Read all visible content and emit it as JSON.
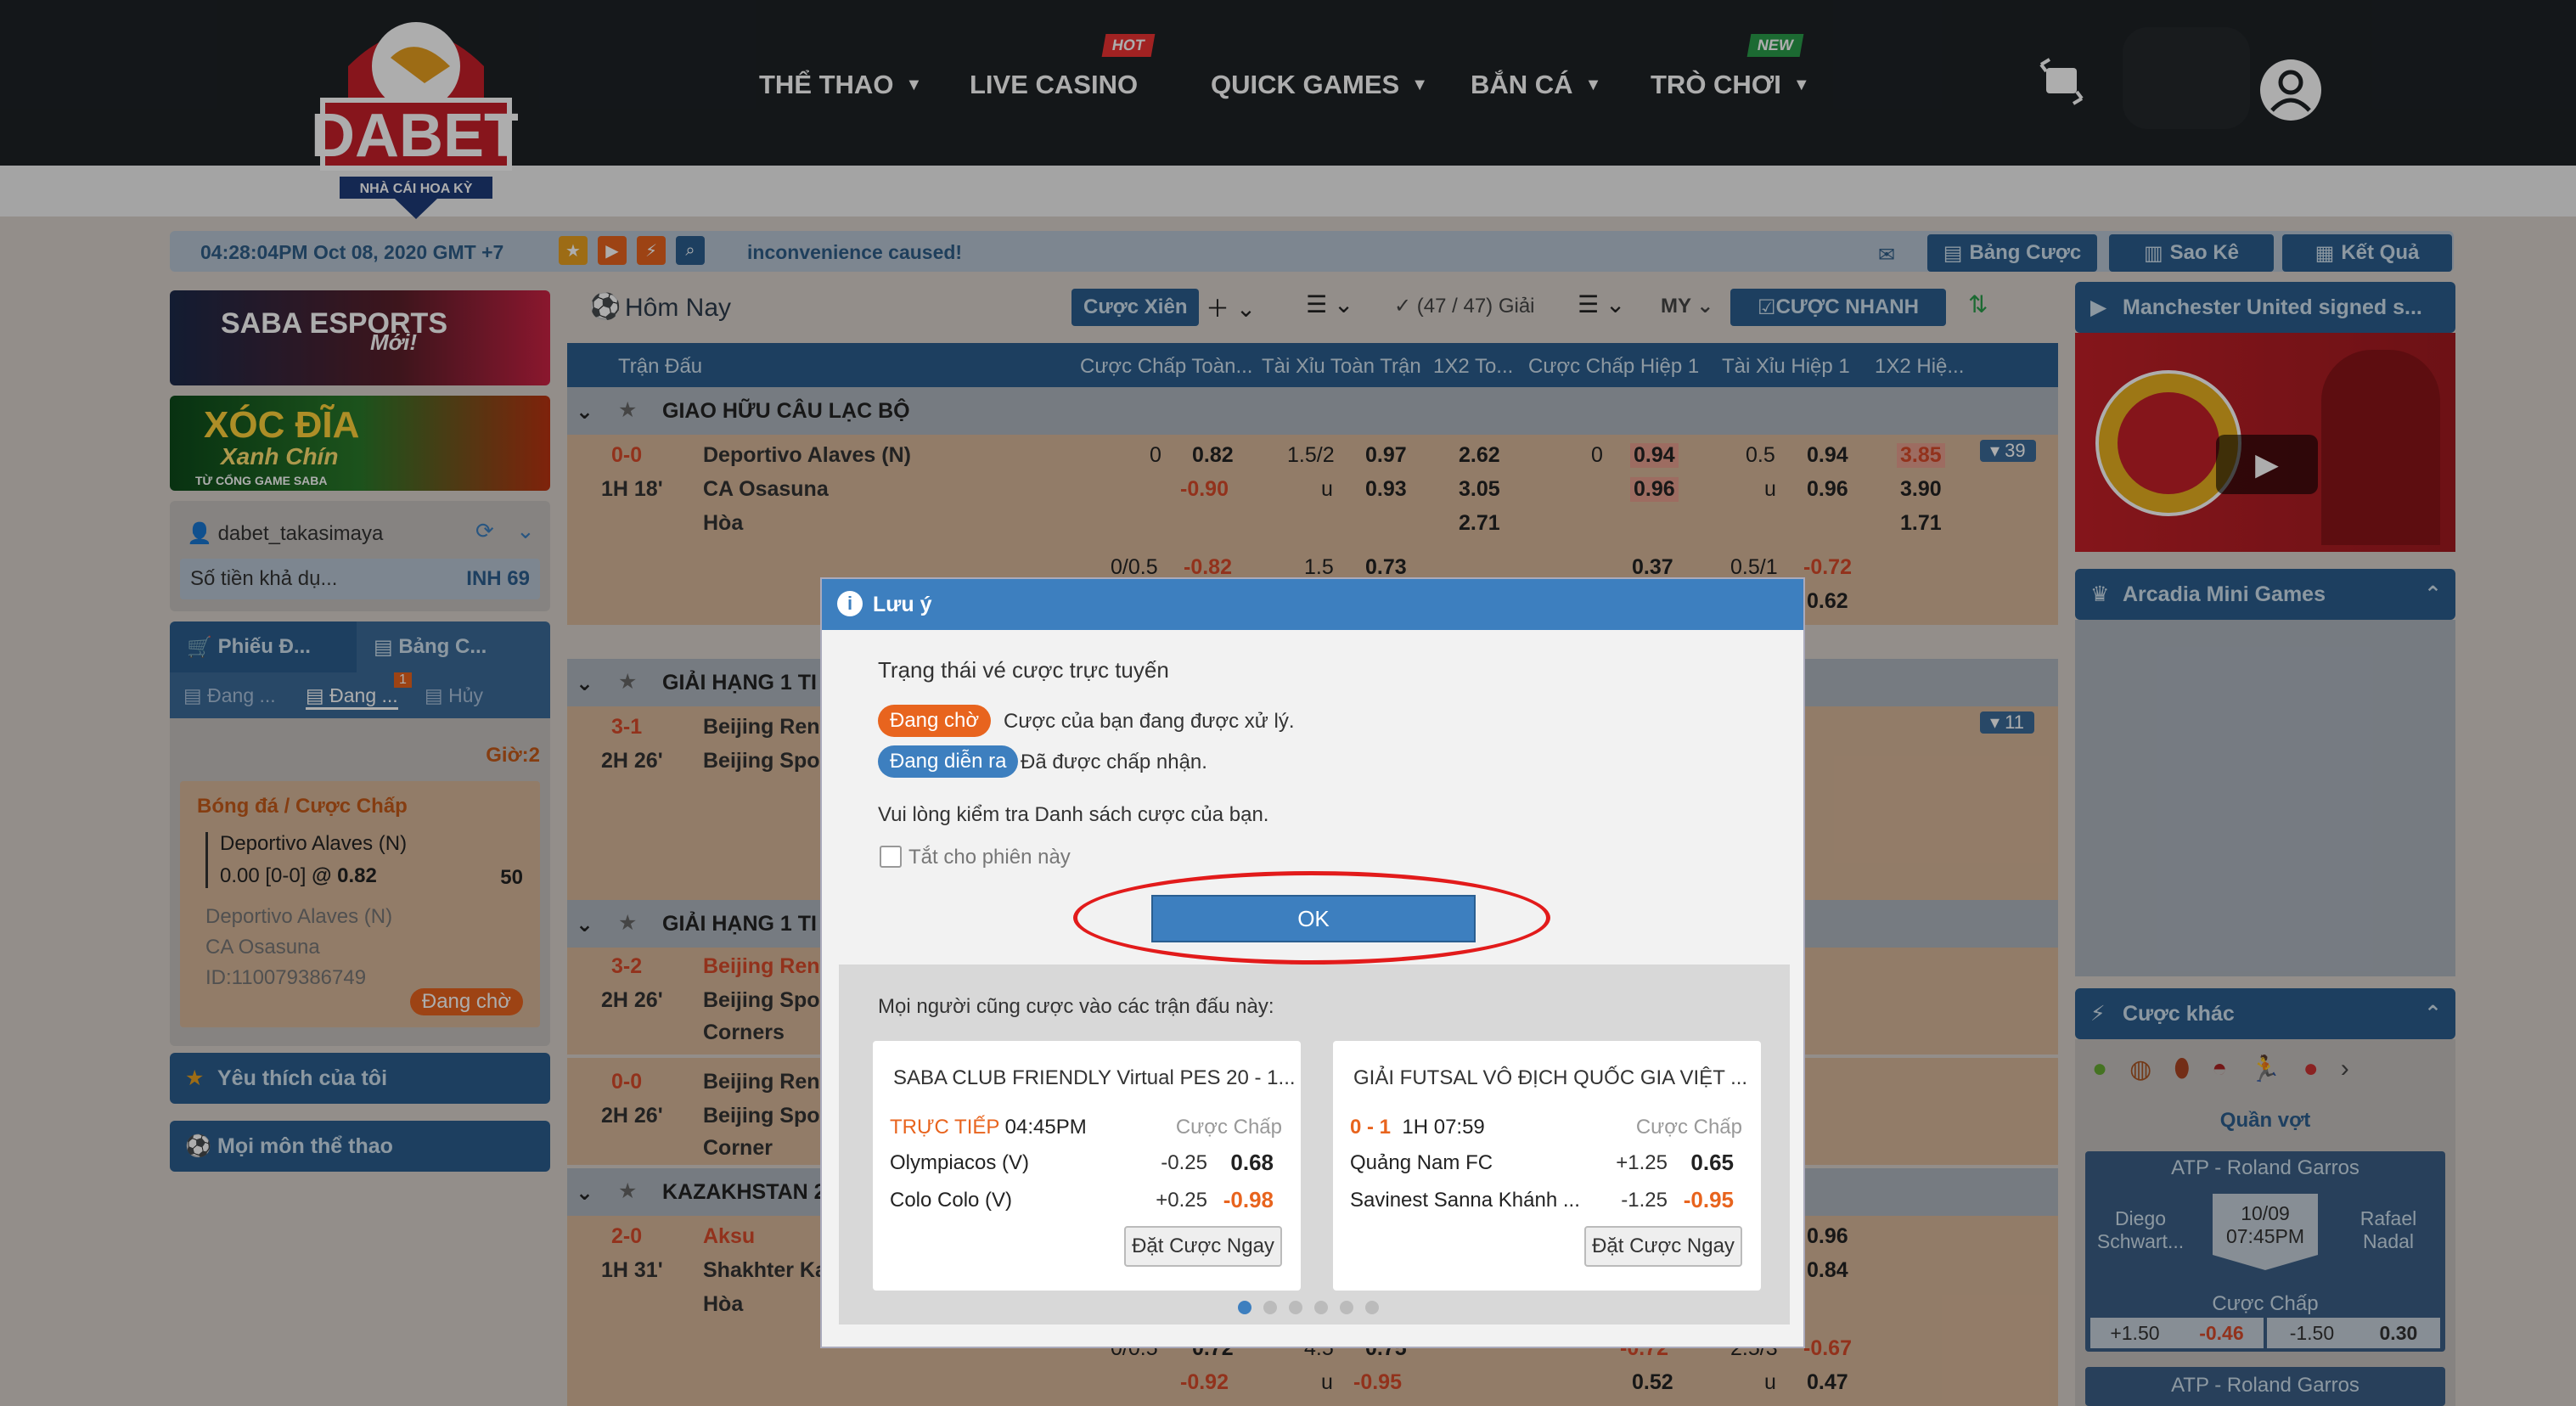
{
  "brand": {
    "logo_text": "DABET",
    "logo_sub": "NHÀ CÁI HOA KỲ"
  },
  "nav": {
    "sports": "THỂ THAO",
    "live_casino": "LIVE CASINO",
    "quick_games": "QUICK GAMES",
    "fishing": "BẮN CÁ",
    "games": "TRÒ CHƠI",
    "hot_tag": "HOT",
    "new_tag": "NEW"
  },
  "infobar": {
    "datetime": "04:28:04PM Oct 08, 2020 GMT +7",
    "marquee": "inconvenience caused!",
    "btn_bet_list": "Bảng Cược",
    "btn_statement": "Sao Kê",
    "btn_results": "Kết Quả"
  },
  "left": {
    "banner1": "SABA ESPORTS",
    "banner1_badge": "Mới!",
    "banner2": "XÓC ĐĨA",
    "banner2_sub": "Xanh Chín",
    "banner2_foot": "TỪ CỔNG GAME SABA",
    "username": "dabet_takasimaya",
    "balance_label": "Số tiền khả dụ...",
    "balance_value": "INH 69",
    "tab_slip": "Phiếu Đ...",
    "tab_bets": "Bảng C...",
    "sub_pending": "Đang ...",
    "sub_running": "Đang ...",
    "sub_cancel": "Hủy",
    "sub_badge": "1",
    "time_label": "Giờ:2",
    "bet_type": "Bóng đá / Cược Chấp",
    "bet_team": "Deportivo Alaves (N)",
    "bet_line": "0.00 [0-0]",
    "bet_at": "@",
    "bet_odds": "0.82",
    "bet_stake": "50",
    "bet_home": "Deportivo Alaves (N)",
    "bet_away": "CA Osasuna",
    "bet_id": "ID:110079386749",
    "bet_status": "Đang chờ",
    "favorites": "Yêu thích của tôi",
    "all_sports": "Mọi môn thể thao"
  },
  "mid": {
    "title": "Hôm Nay",
    "btn_parlay": "Cược Xiên",
    "count": "(47 / 47) Giải",
    "odds_type": "MY",
    "quick_bet": "CƯỢC NHANH",
    "cols": [
      "Trận Đấu",
      "Cược Chấp Toàn...",
      "Tài Xỉu Toàn Trận",
      "1X2 To...",
      "Cược Chấp Hiệp 1",
      "Tài Xỉu Hiệp 1",
      "1X2 Hiệ..."
    ],
    "leagues": [
      "GIAO HỮU CÂU LẠC BỘ",
      "GIẢI HẠNG 1 TI",
      "GIẢI HẠNG 1 TI",
      "KAZAKHSTAN 2"
    ],
    "m1": {
      "score": "0-0",
      "time": "1H 18'",
      "home": "Deportivo Alaves (N)",
      "away": "CA Osasuna",
      "draw": "Hòa",
      "hdp": "0",
      "h1": "0.82",
      "h2": "-0.90",
      "ou": "1.5/2",
      "ouu": "u",
      "o1": "0.97",
      "o2": "0.93",
      "x1": "2.62",
      "x2": "3.05",
      "x3": "2.71",
      "fh": "0",
      "f1": "0.94",
      "f2": "0.96",
      "fou": "0.5",
      "fouu": "u",
      "fo1": "0.94",
      "fo2": "0.96",
      "fx1": "3.85",
      "fx2": "3.90",
      "fx3": "1.71",
      "more": "39",
      "r2": {
        "hdp": "0/0.5",
        "h": "-0.82",
        "ou": "1.5",
        "o": "0.73",
        "f": "0.37",
        "fou": "0.5/1",
        "fo": "-0.72",
        "fo2": "0.62"
      }
    },
    "m2": {
      "score": "3-1",
      "time": "2H 26'",
      "home": "Beijing Ren",
      "away": "Beijing Spo",
      "more": "11"
    },
    "m3": {
      "score": "3-2",
      "time": "2H 26'",
      "home": "Beijing Ren",
      "away": "Beijing Spo",
      "extra": "Corners"
    },
    "m4": {
      "score": "0-0",
      "time": "2H 26'",
      "home": "Beijing Ren",
      "away": "Beijing Spo",
      "extra": "Corner"
    },
    "m5": {
      "score": "2-0",
      "time": "1H 31'",
      "home": "Aksu",
      "away": "Shakhter Ka",
      "draw": "Hòa",
      "r1": "0.96",
      "r2": "0.84",
      "bot": {
        "hdp": "0/0.5",
        "a": "0.72",
        "b": "-0.92",
        "ou": "4.5",
        "ouu": "u",
        "c": "0.75",
        "d": "-0.95",
        "e": "-0.72",
        "f": "0.52",
        "fou": "2.5/3",
        "fouu": "u",
        "g": "-0.67",
        "h": "0.47"
      }
    }
  },
  "right": {
    "video_title": "Manchester United signed s...",
    "arcadia": "Arcadia Mini Games",
    "other_bets": "Cược khác",
    "boxing": "Quần vợt",
    "atp": "ATP - Roland Garros",
    "p1": "Diego Schwart...",
    "p2": "Rafael Nadal",
    "date": "10/09",
    "time": "07:45PM",
    "market": "Cược Chấp",
    "a1": "+1.50",
    "a2": "-0.46",
    "a3": "-1.50",
    "a4": "0.30",
    "atp2": "ATP - Roland Garros"
  },
  "modal": {
    "title": "Lưu ý",
    "heading": "Trạng thái vé cược trực tuyến",
    "pending": "Đang chờ",
    "pending_desc": "Cược của bạn đang được xử lý.",
    "running": "Đang diễn ra",
    "running_desc": "Đã được chấp nhận.",
    "check_msg": "Vui lòng kiểm tra Danh sách cược của bạn.",
    "off_label": "Tắt cho phiên này",
    "ok": "OK",
    "suggest_title": "Mọi người cũng cược vào các trận đấu này:",
    "card1": {
      "title": "SABA CLUB FRIENDLY Virtual PES 20 - 1...",
      "live": "TRỰC TIẾP",
      "time": "04:45PM",
      "market": "Cược Chấp",
      "t1": "Olympiacos (V)",
      "h1": "-0.25",
      "o1": "0.68",
      "t2": "Colo Colo (V)",
      "h2": "+0.25",
      "o2": "-0.98",
      "btn": "Đặt Cược Ngay"
    },
    "card2": {
      "title": "GIẢI FUTSAL VÔ ĐỊCH QUỐC GIA VIỆT ...",
      "score": "0 - 1",
      "time": "1H 07:59",
      "market": "Cược Chấp",
      "t1": "Quảng Nam FC",
      "h1": "+1.25",
      "o1": "0.65",
      "t2": "Savinest Sanna Khánh ...",
      "h2": "-1.25",
      "o2": "-0.95",
      "btn": "Đặt Cược Ngay"
    }
  },
  "colors": {
    "topbar": "#1e2226",
    "accent": "#2c5e8e",
    "modal_header": "#3d7fbf",
    "pending": "#e8641e",
    "running": "#3d7fbf",
    "ring": "#e21b1b"
  }
}
